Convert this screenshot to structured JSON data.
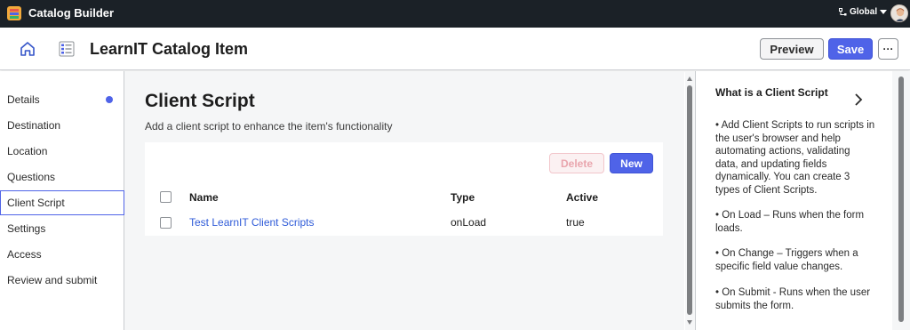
{
  "app": {
    "title": "Catalog Builder",
    "scope": "Global"
  },
  "header": {
    "title": "LearnIT Catalog Item",
    "preview_label": "Preview",
    "save_label": "Save",
    "more_label": "···"
  },
  "nav": {
    "items": [
      {
        "label": "Details"
      },
      {
        "label": "Destination"
      },
      {
        "label": "Location"
      },
      {
        "label": "Questions"
      },
      {
        "label": "Client Script"
      },
      {
        "label": "Settings"
      },
      {
        "label": "Access"
      },
      {
        "label": "Review and submit"
      }
    ],
    "active": "Client Script"
  },
  "main": {
    "title": "Client Script",
    "subtitle": "Add a client script to enhance the item's functionality",
    "delete_label": "Delete",
    "new_label": "New",
    "columns": [
      "Name",
      "Type",
      "Active"
    ],
    "rows": [
      {
        "name": "Test LearnIT Client Scripts",
        "type": "onLoad",
        "active": "true"
      }
    ]
  },
  "panel": {
    "title": "What is a Client Script",
    "bullets": [
      "•    Add Client Scripts to run scripts in the user's browser and help automating actions, validating data, and updating fields dynamically. You can create 3 types of Client Scripts.",
      "•    On Load – Runs when the form loads.",
      "•    On Change – Triggers when a specific field value changes.",
      "•    On Submit - Runs when the user submits the form."
    ]
  },
  "colors": {
    "topbar": "#1b2127",
    "accent": "#4f63e8",
    "link": "#2f5bd8",
    "delete_disabled": "#e9a5ad"
  }
}
